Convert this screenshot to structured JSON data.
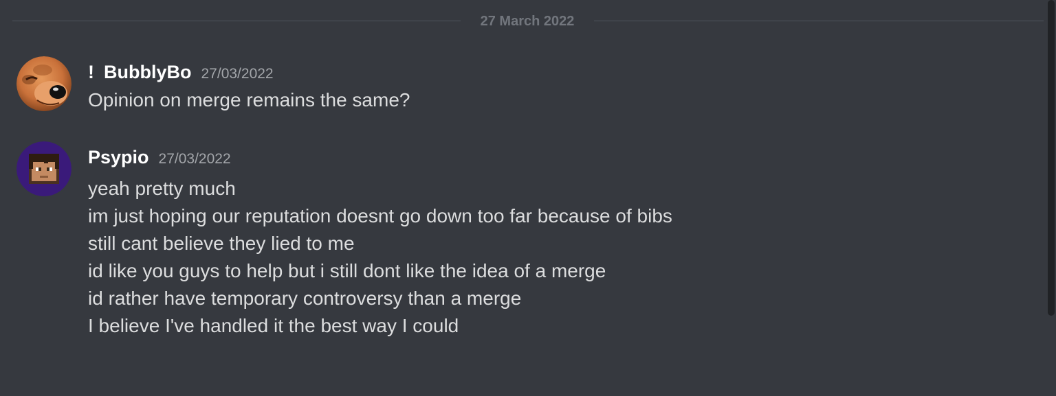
{
  "date_divider": "27 March 2022",
  "messages": [
    {
      "author_prefix": "!",
      "author": "BubblyBo",
      "timestamp": "27/03/2022",
      "avatar_icon": "dog-face-avatar",
      "lines": [
        "Opinion on merge remains the same?"
      ]
    },
    {
      "author": "Psypio",
      "timestamp": "27/03/2022",
      "avatar_icon": "pixel-character-avatar",
      "lines": [
        "yeah pretty much",
        "im just hoping our reputation doesnt go down too far because of bibs",
        "still cant believe they lied to me",
        "id like you guys to help but i still dont like the idea of a merge",
        "id rather have temporary controversy than a merge",
        "I believe I've handled it the best way I could"
      ]
    }
  ],
  "colors": {
    "background": "#36393f",
    "username": "#ffffff",
    "message_text": "#dcddde",
    "timestamp": "#a3a6aa",
    "divider": "#4f545c"
  }
}
